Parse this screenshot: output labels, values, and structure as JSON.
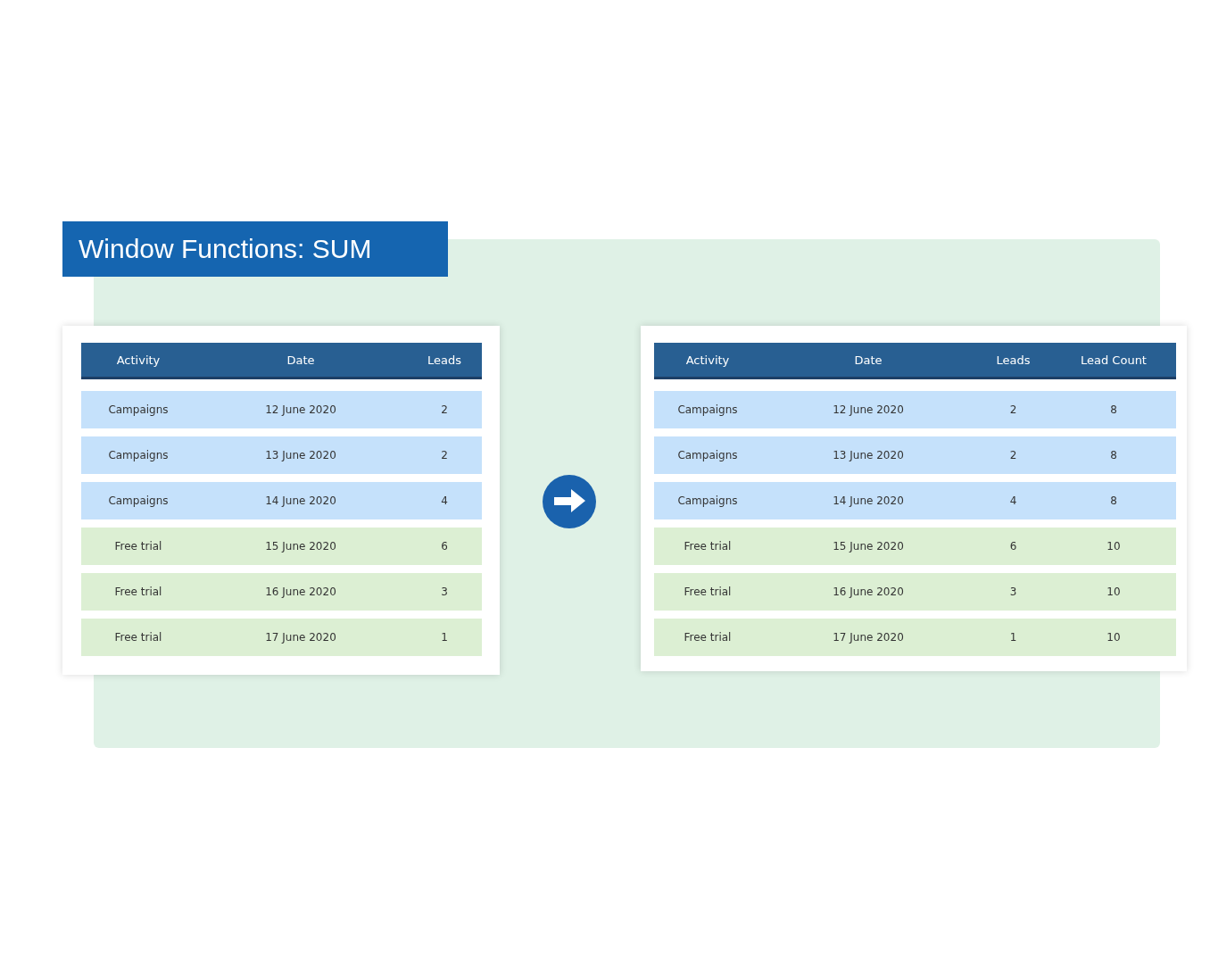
{
  "title": "Window Functions: SUM",
  "tables": [
    {
      "columns": [
        "Activity",
        "Date",
        "Leads"
      ],
      "rows": [
        {
          "cells": [
            "Campaigns",
            "12 June 2020",
            "2"
          ],
          "color": "#c5e1fb"
        },
        {
          "cells": [
            "Campaigns",
            "13 June 2020",
            "2"
          ],
          "color": "#c5e1fb"
        },
        {
          "cells": [
            "Campaigns",
            "14 June 2020",
            "4"
          ],
          "color": "#c5e1fb"
        },
        {
          "cells": [
            "Free trial",
            "15 June 2020",
            "6"
          ],
          "color": "#dcefd3"
        },
        {
          "cells": [
            "Free trial",
            "16 June 2020",
            "3"
          ],
          "color": "#dcefd3"
        },
        {
          "cells": [
            "Free trial",
            "17 June 2020",
            "1"
          ],
          "color": "#dcefd3"
        }
      ]
    },
    {
      "columns": [
        "Activity",
        "Date",
        "Leads",
        "Lead Count"
      ],
      "rows": [
        {
          "cells": [
            "Campaigns",
            "12 June 2020",
            "2",
            "8"
          ],
          "color": "#c5e1fb"
        },
        {
          "cells": [
            "Campaigns",
            "13 June 2020",
            "2",
            "8"
          ],
          "color": "#c5e1fb"
        },
        {
          "cells": [
            "Campaigns",
            "14 June 2020",
            "4",
            "8"
          ],
          "color": "#c5e1fb"
        },
        {
          "cells": [
            "Free trial",
            "15 June 2020",
            "6",
            "10"
          ],
          "color": "#dcefd3"
        },
        {
          "cells": [
            "Free trial",
            "16 June 2020",
            "3",
            "10"
          ],
          "color": "#dcefd3"
        },
        {
          "cells": [
            "Free trial",
            "17 June 2020",
            "1",
            "10"
          ],
          "color": "#dcefd3"
        }
      ]
    }
  ]
}
